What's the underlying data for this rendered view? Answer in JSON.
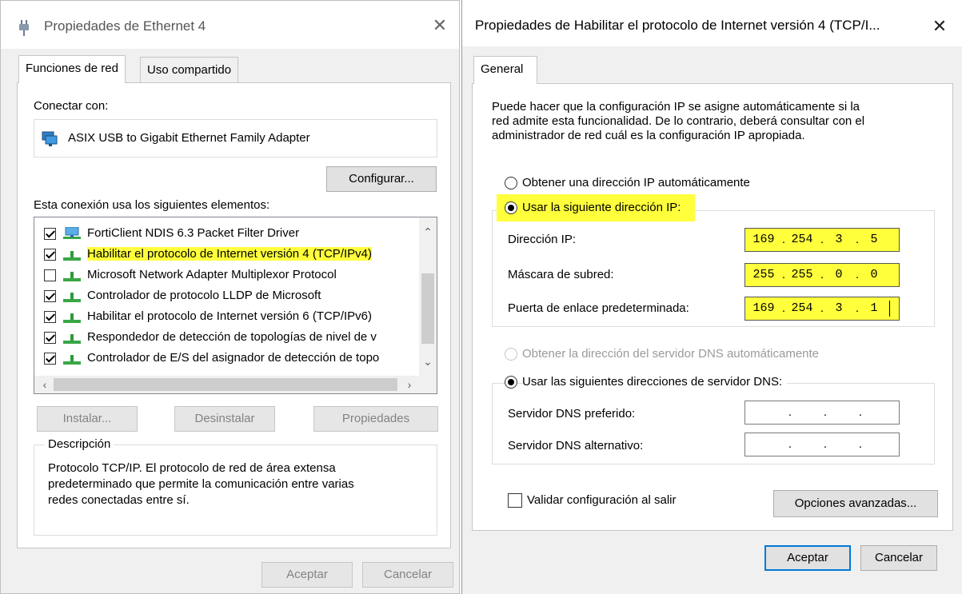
{
  "left_window": {
    "title": "Propiedades de Ethernet 4",
    "close_glyph": "✕",
    "tabs": [
      {
        "label": "Funciones de red"
      },
      {
        "label": "Uso compartido"
      }
    ],
    "connect_with_label": "Conectar con:",
    "adapter_name": "ASIX USB to Gigabit Ethernet Family Adapter",
    "configure_button": "Configurar...",
    "elements_label": "Esta conexión usa los siguientes elementos:",
    "items": [
      {
        "label": "FortiClient NDIS 6.3 Packet Filter Driver",
        "checked": true
      },
      {
        "label": "Habilitar el protocolo de Internet versión 4 (TCP/IPv4)",
        "checked": true
      },
      {
        "label": "Microsoft Network Adapter Multiplexor Protocol",
        "checked": false
      },
      {
        "label": "Controlador de protocolo LLDP de Microsoft",
        "checked": true
      },
      {
        "label": "Habilitar el protocolo de Internet versión 6 (TCP/IPv6)",
        "checked": true
      },
      {
        "label": "Respondedor de detección de topologías de nivel de v",
        "checked": true
      },
      {
        "label": "Controlador de E/S del asignador de detección de topo",
        "checked": true
      }
    ],
    "install_button": "Instalar...",
    "uninstall_button": "Desinstalar",
    "properties_button": "Propiedades",
    "description_title": "Descripción",
    "description_line1": "Protocolo TCP/IP. El protocolo de red de área extensa",
    "description_line2": "predeterminado que permite la comunicación entre varias",
    "description_line3": "redes conectadas entre sí.",
    "accept_button": "Aceptar",
    "cancel_button": "Cancelar"
  },
  "right_window": {
    "title": "Propiedades de Habilitar el protocolo de Internet versión 4 (TCP/I...",
    "close_glyph": "✕",
    "tab_label": "General",
    "intro_line1": "Puede hacer que la configuración IP se asigne automáticamente si la",
    "intro_line2": "red admite esta funcionalidad. De lo contrario, deberá consultar con el",
    "intro_line3": "administrador de red cuál es la configuración IP apropiada.",
    "auto_ip_label": "Obtener una dirección IP automáticamente",
    "manual_ip_label": "Usar la siguiente dirección IP:",
    "ip_address_label": "Dirección IP:",
    "ip_address": [
      "169",
      "254",
      "3",
      "5"
    ],
    "subnet_label": "Máscara de subred:",
    "subnet": [
      "255",
      "255",
      "0",
      "0"
    ],
    "gateway_label": "Puerta de enlace predeterminada:",
    "gateway": [
      "169",
      "254",
      "3",
      "1"
    ],
    "auto_dns_label": "Obtener la dirección del servidor DNS automáticamente",
    "manual_dns_label": "Usar las siguientes direcciones de servidor DNS:",
    "preferred_dns_label": "Servidor DNS preferido:",
    "alternate_dns_label": "Servidor DNS alternativo:",
    "validate_label": "Validar configuración al salir",
    "advanced_button": "Opciones avanzadas...",
    "accept_button": "Aceptar",
    "cancel_button": "Cancelar"
  },
  "colors": {
    "highlight": "#ffff3c",
    "accent": "#0078d7",
    "window_bg": "#f0f0f0"
  }
}
